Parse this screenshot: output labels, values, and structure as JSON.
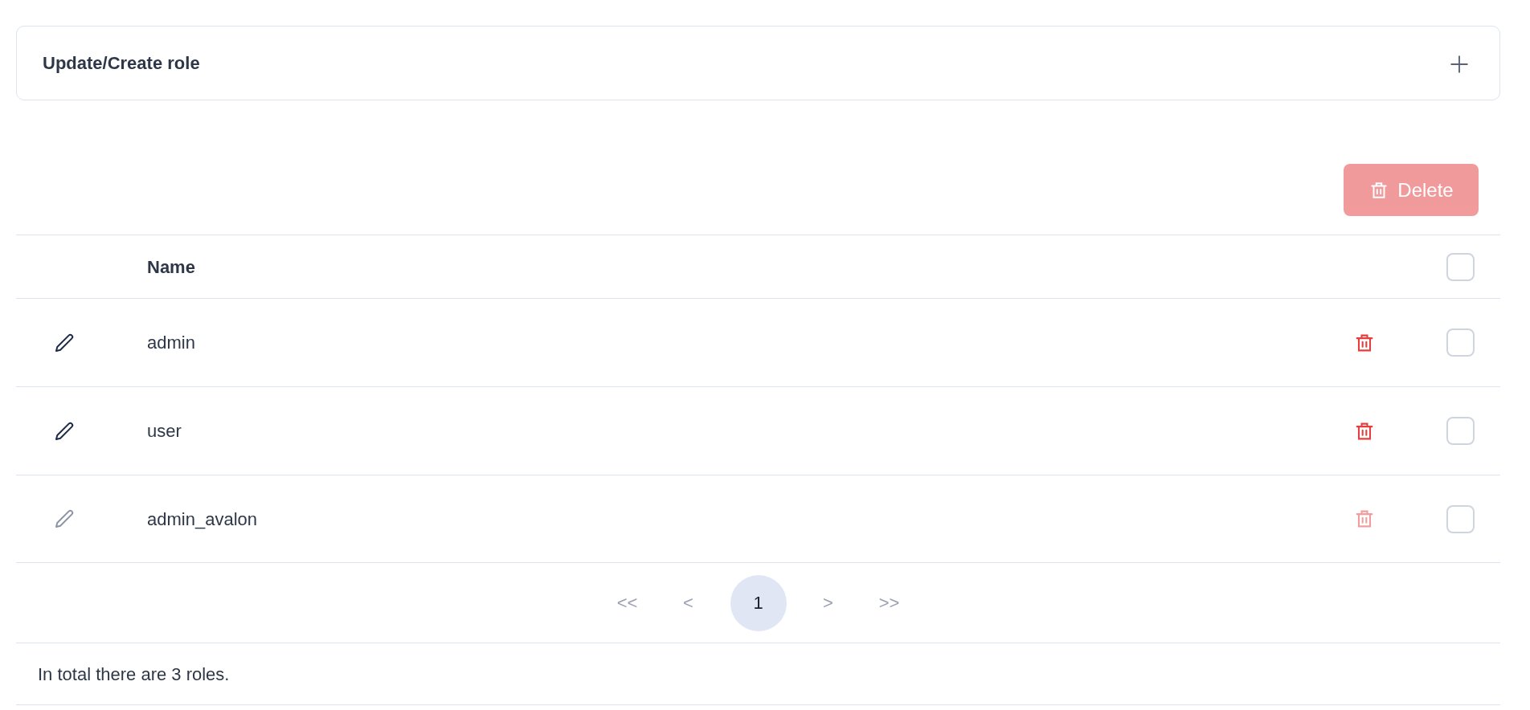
{
  "panel": {
    "title": "Update/Create role",
    "expanded": false
  },
  "toolbar": {
    "delete_button": {
      "label": "Delete",
      "disabled": true
    }
  },
  "table": {
    "columns": [
      "Name"
    ],
    "select_all": {
      "checked": false
    },
    "rows": [
      {
        "name": "admin",
        "disabled": false,
        "checked": false
      },
      {
        "name": "user",
        "disabled": false,
        "checked": false
      },
      {
        "name": "admin_avalon",
        "disabled": true,
        "checked": false
      }
    ]
  },
  "pagination": {
    "first": "<<",
    "prev": "<",
    "pages": [
      {
        "label": "1",
        "selected": true
      }
    ],
    "next": ">",
    "last": ">>"
  },
  "footer": "In total there are 3 roles."
}
